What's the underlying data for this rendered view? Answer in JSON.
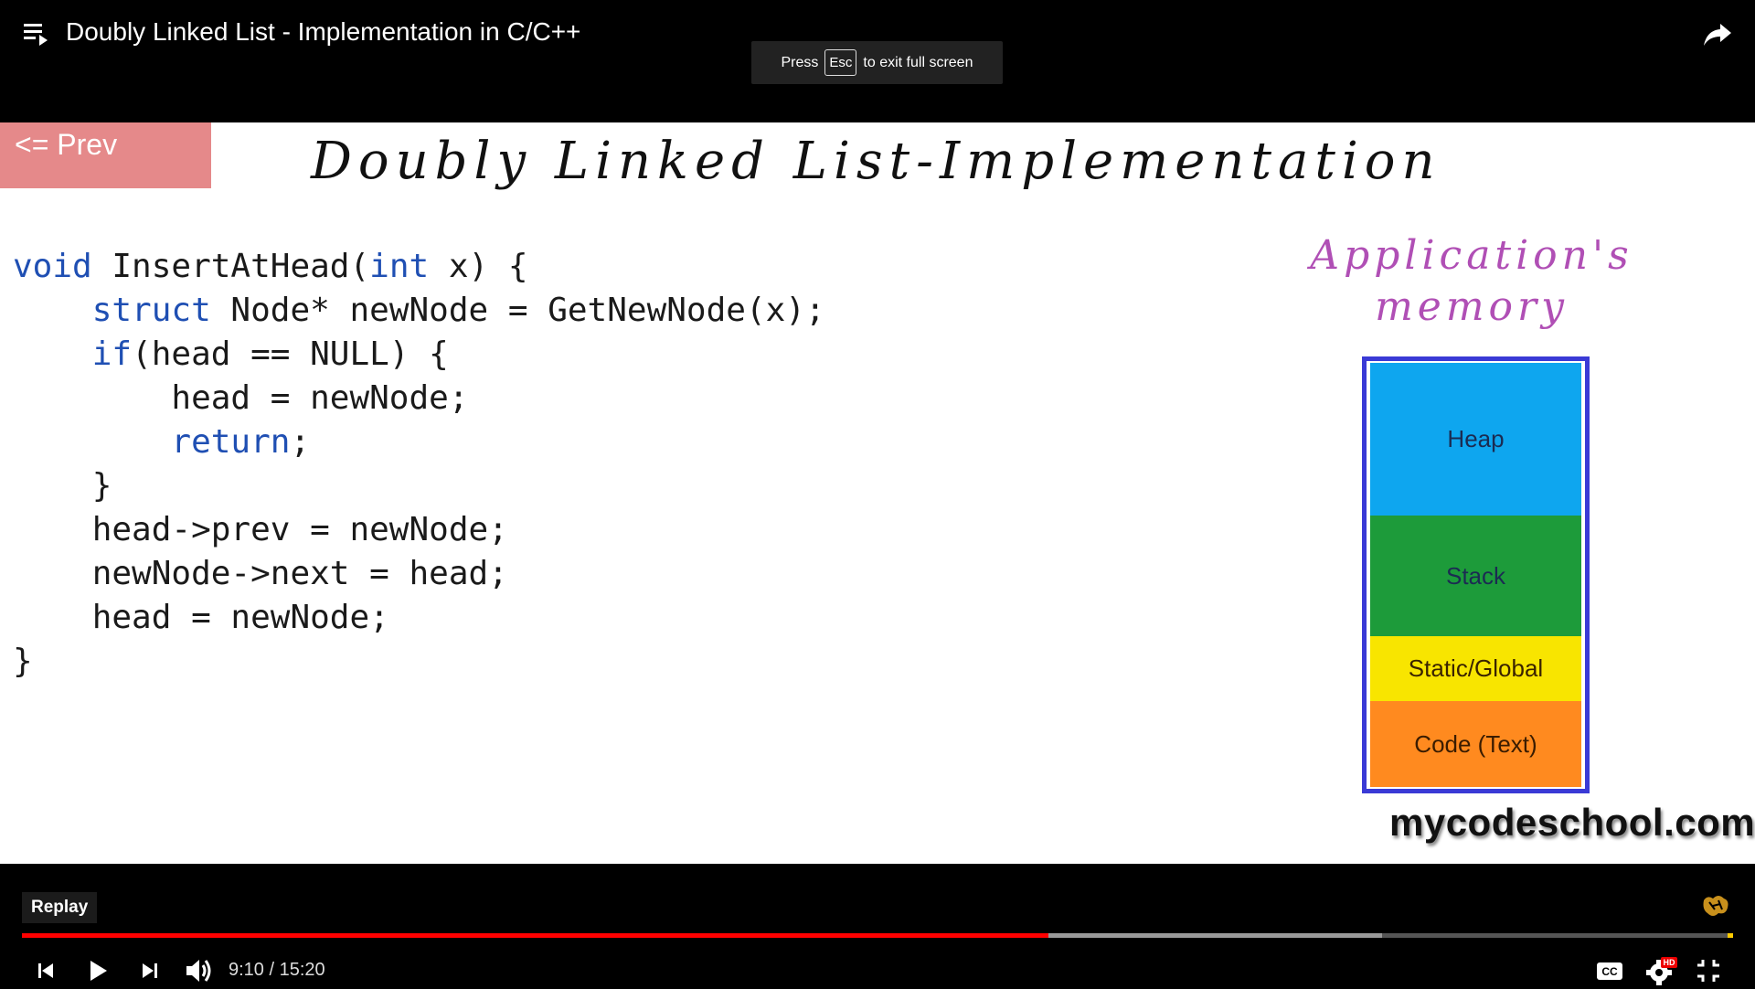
{
  "header": {
    "title": "Doubly Linked List - Implementation in C/C++",
    "fullscreen_hint": {
      "press": "Press",
      "key": "Esc",
      "suffix": "to exit full screen"
    }
  },
  "slide": {
    "prev_label": "<= Prev",
    "title": "Doubly Linked List-Implementation",
    "code_lines": [
      {
        "indent": "",
        "kw": "void",
        "rest": " InsertAtHead(int x) {"
      },
      {
        "indent": "    ",
        "kw": "struct",
        "rest": " Node* newNode = GetNewNode(x);"
      },
      {
        "indent": "    ",
        "kw": "if",
        "rest": "(head == NULL) {"
      },
      {
        "indent": "        ",
        "kw": "",
        "rest": "head = newNode;"
      },
      {
        "indent": "        ",
        "kw": "return",
        "rest": ";"
      },
      {
        "indent": "    ",
        "kw": "",
        "rest": "}"
      },
      {
        "indent": "    ",
        "kw": "",
        "rest": "head->prev = newNode;"
      },
      {
        "indent": "    ",
        "kw": "",
        "rest": "newNode->next = head;"
      },
      {
        "indent": "    ",
        "kw": "",
        "rest": "head = newNode;"
      },
      {
        "indent": "",
        "kw": "",
        "rest": "}"
      }
    ],
    "memory": {
      "title_line1": "Application's",
      "title_line2": "memory",
      "segments": [
        "Heap",
        "Stack",
        "Static/Global",
        "Code (Text)"
      ]
    },
    "site": "mycodeschool.com"
  },
  "player": {
    "replay_label": "Replay",
    "current_time": "9:10",
    "duration": "15:20",
    "time_display": "9:10 / 15:20",
    "progress_played": 0.6,
    "progress_buffered": 0.795,
    "icons": [
      "playlist-icon",
      "share-icon",
      "previous-icon",
      "play-icon",
      "next-icon",
      "volume-icon",
      "subtitles-icon",
      "settings-icon",
      "exit-fullscreen-icon"
    ],
    "hd_badge": "HD"
  },
  "colors": {
    "progress": "#ff0000",
    "prev_button": "#e5898a",
    "heap": "#0ea6ef",
    "stack": "#1d9b3a",
    "static": "#f8e500",
    "code": "#ff8a1f",
    "memory_title": "#b04fb5"
  }
}
